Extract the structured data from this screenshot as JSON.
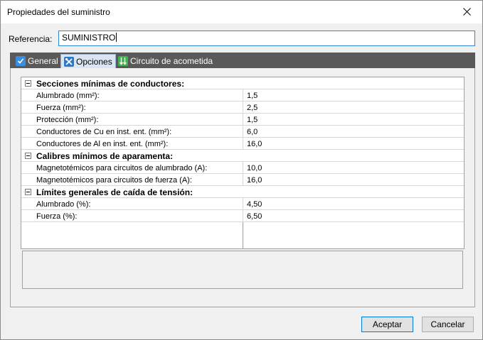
{
  "window": {
    "title": "Propiedades del suministro"
  },
  "referencia": {
    "label": "Referencia:",
    "value": "SUMINISTRO"
  },
  "tabs": [
    {
      "label": "General",
      "icon": "checkbox-icon"
    },
    {
      "label": "Opciones",
      "icon": "tools-icon"
    },
    {
      "label": "Circuito de acometida",
      "icon": "circuit-icon"
    }
  ],
  "active_tab": "Opciones",
  "groups": [
    {
      "title": "Secciones mínimas de conductores:",
      "rows": [
        {
          "label": "Alumbrado (mm²):",
          "value": "1,5"
        },
        {
          "label": "Fuerza (mm²):",
          "value": "2,5"
        },
        {
          "label": "Protección (mm²):",
          "value": "1,5"
        },
        {
          "label": "Conductores de Cu en inst. ent. (mm²):",
          "value": "6,0"
        },
        {
          "label": "Conductores de Al en inst. ent. (mm²):",
          "value": "16,0"
        }
      ]
    },
    {
      "title": "Calibres mínimos de aparamenta:",
      "rows": [
        {
          "label": "Magnetotémicos para circuitos de alumbrado (A):",
          "value": "10,0"
        },
        {
          "label": "Magnetotémicos para circuitos de fuerza (A):",
          "value": "16,0"
        }
      ]
    },
    {
      "title": "Límites generales de caída de tensión:",
      "rows": [
        {
          "label": "Alumbrado (%):",
          "value": "4,50"
        },
        {
          "label": "Fuerza (%):",
          "value": "6,50"
        }
      ]
    }
  ],
  "buttons": {
    "ok": "Aceptar",
    "cancel": "Cancelar"
  },
  "colors": {
    "tabbar": "#595959",
    "active_tab": "#d9e5f2",
    "focus_border": "#0078d7"
  }
}
